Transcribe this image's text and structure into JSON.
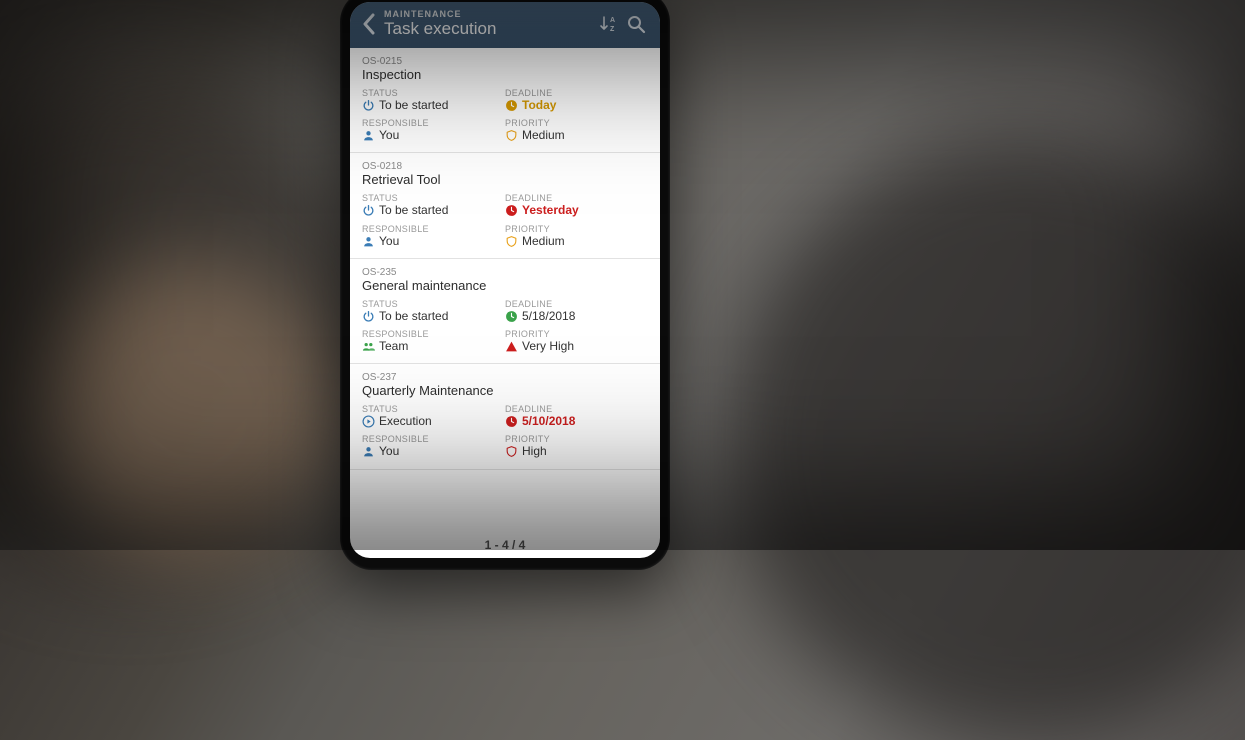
{
  "header": {
    "module": "MAINTENANCE",
    "page_title": "Task execution"
  },
  "labels": {
    "status": "STATUS",
    "deadline": "DEADLINE",
    "responsible": "RESPONSIBLE",
    "priority": "PRIORITY"
  },
  "colors": {
    "header_bg_top": "#4d6a86",
    "header_bg_bottom": "#39536d",
    "accent_blue": "#3b7db6",
    "warn_amber": "#d79a00",
    "ok_green": "#3aa24a",
    "danger_red": "#cc1e1e",
    "priority_orange": "#e8a018"
  },
  "tasks": [
    {
      "id": "OS-0215",
      "title": "Inspection",
      "status": "To be started",
      "status_icon": "power",
      "deadline": "Today",
      "deadline_state": "today",
      "responsible": "You",
      "responsible_icon": "person",
      "priority": "Medium",
      "priority_icon": "shield-open",
      "priority_color": "#e8a018"
    },
    {
      "id": "OS-0218",
      "title": "Retrieval Tool",
      "status": "To be started",
      "status_icon": "power",
      "deadline": "Yesterday",
      "deadline_state": "late",
      "responsible": "You",
      "responsible_icon": "person",
      "priority": "Medium",
      "priority_icon": "shield-open",
      "priority_color": "#e8a018"
    },
    {
      "id": "OS-235",
      "title": "General maintenance",
      "status": "To be started",
      "status_icon": "power",
      "deadline": "5/18/2018",
      "deadline_state": "ok",
      "responsible": "Team",
      "responsible_icon": "team",
      "priority": "Very High",
      "priority_icon": "triangle",
      "priority_color": "#cc1e1e"
    },
    {
      "id": "OS-237",
      "title": "Quarterly Maintenance",
      "status": "Execution",
      "status_icon": "play",
      "deadline": "5/10/2018",
      "deadline_state": "late",
      "responsible": "You",
      "responsible_icon": "person",
      "priority": "High",
      "priority_icon": "shield-open",
      "priority_color": "#cc1e1e"
    }
  ],
  "pager": "1 - 4 / 4"
}
